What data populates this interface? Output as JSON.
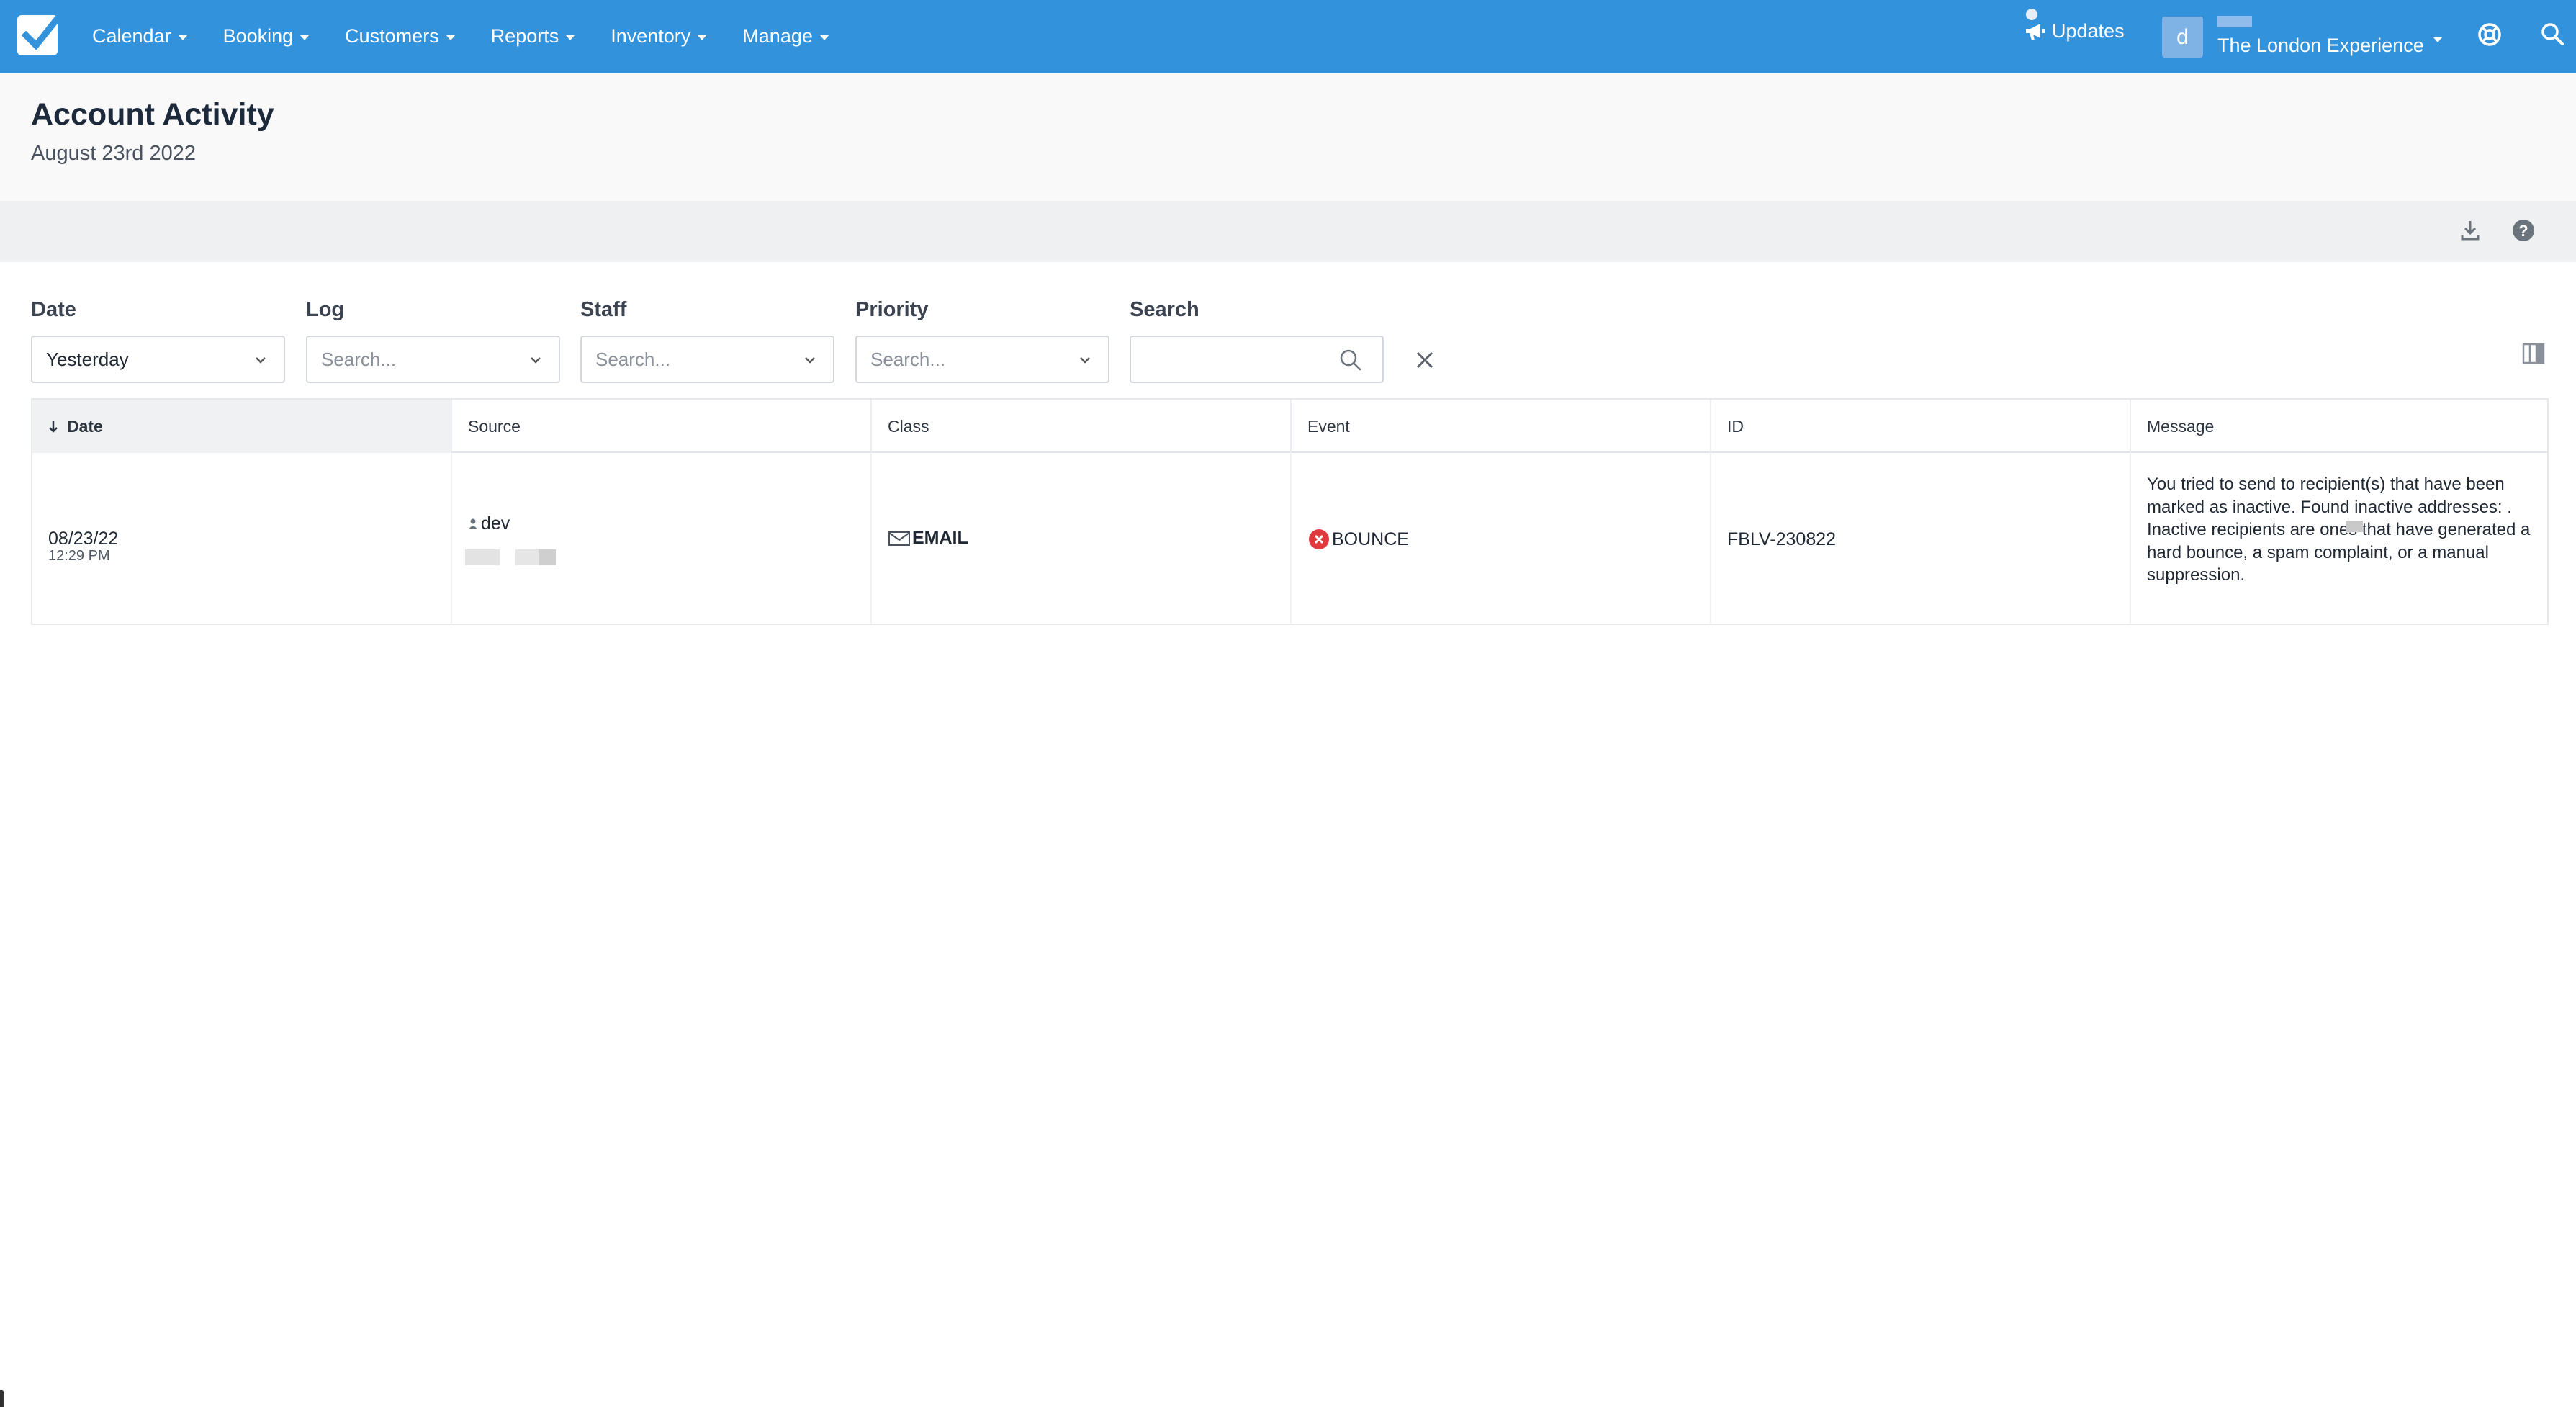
{
  "nav": {
    "items": [
      {
        "label": "Calendar"
      },
      {
        "label": "Booking"
      },
      {
        "label": "Customers"
      },
      {
        "label": "Reports"
      },
      {
        "label": "Inventory"
      },
      {
        "label": "Manage"
      }
    ],
    "updates_label": "Updates",
    "avatar_letter": "d",
    "account_name": "The London Experience"
  },
  "page": {
    "title": "Account Activity",
    "subtitle": "August 23rd 2022"
  },
  "filters": {
    "date": {
      "label": "Date",
      "value": "Yesterday"
    },
    "log": {
      "label": "Log",
      "placeholder": "Search..."
    },
    "staff": {
      "label": "Staff",
      "placeholder": "Search..."
    },
    "priority": {
      "label": "Priority",
      "placeholder": "Search..."
    },
    "search": {
      "label": "Search",
      "value": ""
    }
  },
  "table": {
    "columns": [
      "Date",
      "Source",
      "Class",
      "Event",
      "ID",
      "Message"
    ],
    "rows": [
      {
        "date": "08/23/22",
        "time": "12:29 PM",
        "source": "dev",
        "class": "EMAIL",
        "event": "BOUNCE",
        "id": "FBLV-230822",
        "message": "You tried to send to recipient(s) that have been marked as inactive. Found inactive addresses:                    . Inactive recipients are ones that have generated a hard bounce, a spam complaint, or a manual suppression."
      }
    ]
  },
  "colors": {
    "topbar": "#3293dc",
    "bounce_red": "#e0393e"
  }
}
